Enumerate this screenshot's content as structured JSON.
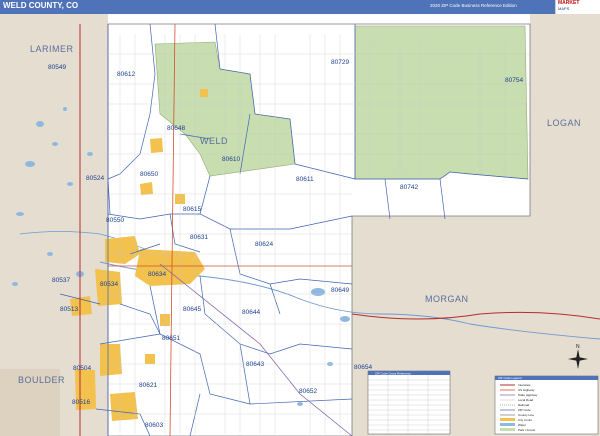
{
  "header": {
    "title": "WELD COUNTY, CO",
    "edition": "2020 ZIP Code Business Reference Edition",
    "logo_top": "MARKET",
    "logo_bottom": "MAPS"
  },
  "counties": {
    "larimer": "LARIMER",
    "logan": "LOGAN",
    "morgan": "MORGAN",
    "boulder": "BOULDER",
    "weld": "WELD"
  },
  "zip_labels": [
    "80549",
    "80612",
    "80729",
    "80754",
    "80648",
    "80610",
    "80650",
    "80524",
    "80611",
    "80742",
    "80615",
    "80550",
    "80631",
    "80624",
    "80634",
    "80537",
    "80534",
    "80649",
    "80513",
    "80645",
    "80644",
    "80651",
    "80504",
    "80643",
    "80654",
    "80621",
    "80652",
    "80516",
    "80603"
  ],
  "legend": {
    "title": "ZIP Code Legend",
    "rows": [
      "Interstate",
      "US Highway",
      "State Highway",
      "Local Road",
      "Railroad",
      "ZIP Code",
      "County Line",
      "City Limits",
      "Water",
      "Park / Forest"
    ]
  },
  "zip_table": {
    "title": "ZIP Code Cross Reference"
  },
  "compass": {
    "label": "N"
  },
  "colors": {
    "header": "#4f73b8",
    "zip_boundary": "#3f63b3",
    "urban": "#f2c14e",
    "park": "#c8ddb0",
    "neighbor": "#e5ddd0",
    "water": "#8fb8e0"
  }
}
